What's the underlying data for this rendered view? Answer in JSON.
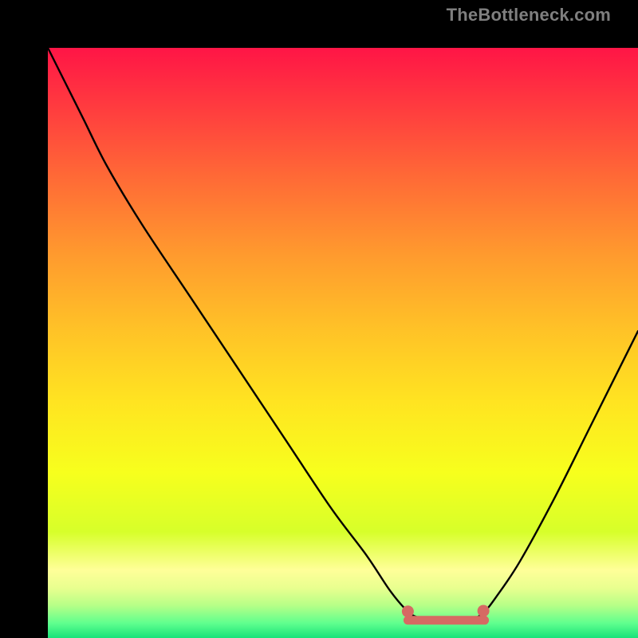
{
  "watermark": "TheBottleneck.com",
  "gradient": {
    "stops": [
      {
        "offset": 0.0,
        "color": "#ff1546"
      },
      {
        "offset": 0.1,
        "color": "#ff3b3f"
      },
      {
        "offset": 0.22,
        "color": "#ff6a36"
      },
      {
        "offset": 0.35,
        "color": "#ff9a2e"
      },
      {
        "offset": 0.48,
        "color": "#ffc327"
      },
      {
        "offset": 0.6,
        "color": "#ffe421"
      },
      {
        "offset": 0.72,
        "color": "#f7ff1d"
      },
      {
        "offset": 0.82,
        "color": "#d7ff2a"
      },
      {
        "offset": 0.885,
        "color": "#ffff99"
      },
      {
        "offset": 0.915,
        "color": "#e9ff8f"
      },
      {
        "offset": 0.945,
        "color": "#b6ff87"
      },
      {
        "offset": 0.975,
        "color": "#5fff8e"
      },
      {
        "offset": 1.0,
        "color": "#19e27a"
      }
    ]
  },
  "marker_color": "#d66a63",
  "curve_color": "#000000",
  "chart_data": {
    "type": "line",
    "title": "",
    "xlabel": "",
    "ylabel": "",
    "xlim": [
      0,
      100
    ],
    "ylim": [
      0,
      100
    ],
    "annotations": [
      "TheBottleneck.com"
    ],
    "series": [
      {
        "name": "bottleneck-curve",
        "x": [
          0,
          2,
          6,
          10,
          16,
          24,
          32,
          40,
          48,
          54,
          58,
          61,
          63,
          66,
          69,
          72,
          74,
          76,
          80,
          86,
          92,
          100
        ],
        "y": [
          100,
          96,
          88,
          80,
          70,
          58,
          46,
          34,
          22,
          14,
          8,
          4.5,
          3.4,
          3.0,
          3.0,
          3.2,
          4.5,
          7,
          13,
          24,
          36,
          52
        ]
      }
    ],
    "markers": {
      "name": "highlight-band",
      "color": "#d66a63",
      "x_range": [
        61,
        74
      ],
      "y": 3.0,
      "endpoints": [
        {
          "x": 61.0,
          "y": 4.5
        },
        {
          "x": 73.8,
          "y": 4.6
        }
      ]
    }
  }
}
